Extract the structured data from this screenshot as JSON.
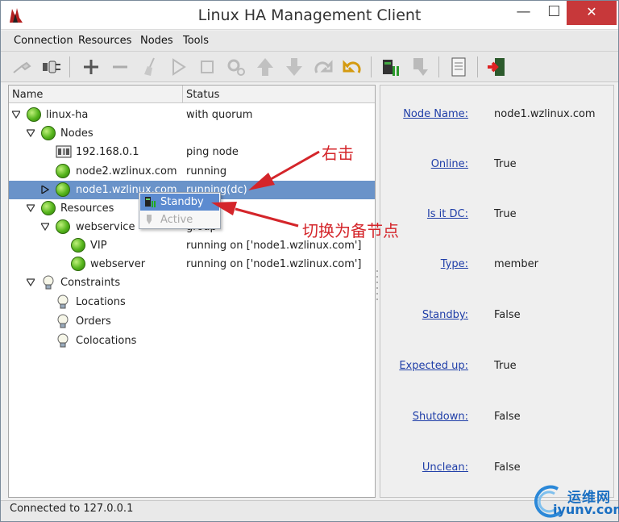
{
  "window": {
    "title": "Linux HA Management Client"
  },
  "menubar": {
    "items": [
      "Connection",
      "Resources",
      "Nodes",
      "Tools"
    ]
  },
  "toolbar": {
    "icons": [
      "connect-icon",
      "disconnect-icon",
      "add-icon",
      "remove-icon",
      "cleanup-icon",
      "start-icon",
      "stop-icon",
      "settings-icon",
      "move-up-icon",
      "move-down-icon",
      "redo-icon",
      "undo-icon",
      "standby-icon",
      "active-icon",
      "view-xml-icon",
      "exit-icon"
    ]
  },
  "tree": {
    "columns": {
      "name": "Name",
      "status": "Status"
    },
    "rows": [
      {
        "label": "linux-ha",
        "status": "with quorum"
      },
      {
        "label": "Nodes",
        "status": ""
      },
      {
        "label": "192.168.0.1",
        "status": "ping node"
      },
      {
        "label": "node2.wzlinux.com",
        "status": "running"
      },
      {
        "label": "node1.wzlinux.com",
        "status": "running(dc)"
      },
      {
        "label": "Resources",
        "status": ""
      },
      {
        "label": "webservice",
        "status": "group"
      },
      {
        "label": "VIP",
        "status": "running on ['node1.wzlinux.com']"
      },
      {
        "label": "webserver",
        "status": "running on ['node1.wzlinux.com']"
      },
      {
        "label": "Constraints",
        "status": ""
      },
      {
        "label": "Locations",
        "status": ""
      },
      {
        "label": "Orders",
        "status": ""
      },
      {
        "label": "Colocations",
        "status": ""
      }
    ]
  },
  "context_menu": {
    "items": [
      {
        "label": "Standby",
        "enabled": true
      },
      {
        "label": "Active",
        "enabled": false
      }
    ]
  },
  "annotations": {
    "right_click": "右击",
    "switch_standby": "切换为备节点"
  },
  "properties": [
    {
      "name": "Node Name:",
      "value": "node1.wzlinux.com"
    },
    {
      "name": "Online:",
      "value": "True"
    },
    {
      "name": "Is it DC:",
      "value": "True"
    },
    {
      "name": "Type:",
      "value": "member"
    },
    {
      "name": "Standby:",
      "value": "False"
    },
    {
      "name": "Expected up:",
      "value": "True"
    },
    {
      "name": "Shutdown:",
      "value": "False"
    },
    {
      "name": "Unclean:",
      "value": "False"
    }
  ],
  "statusbar": {
    "text": "Connected to 127.0.0.1"
  },
  "watermark": {
    "cn": "运维网",
    "en": "iyunv.com"
  },
  "colors": {
    "selection": "#6a93c9",
    "annotation": "#d4252a",
    "link": "#1f3ea8"
  }
}
